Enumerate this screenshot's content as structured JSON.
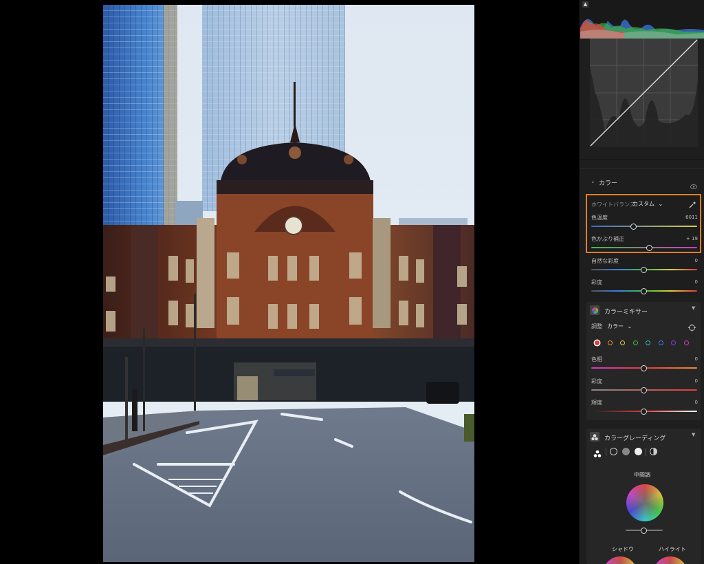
{
  "photo": {
    "description_name": "tokyo-station-photo"
  },
  "tone_curve": {},
  "color_section": {
    "title": "カラー",
    "white_balance": {
      "label": "ホワイトバランス",
      "preset": "カスタム"
    },
    "sliders": [
      {
        "key": "temp",
        "label": "色温度",
        "value": "6011",
        "position": 0.4
      },
      {
        "key": "tint",
        "label": "色かぶり補正",
        "value": "+ 19",
        "position": 0.55
      },
      {
        "key": "vibrance",
        "label": "自然な彩度",
        "value": "0",
        "position": 0.5
      },
      {
        "key": "saturation",
        "label": "彩度",
        "value": "0",
        "position": 0.5
      }
    ]
  },
  "color_mixer": {
    "title": "カラーミキサー",
    "adjust_label": "調整",
    "adjust_value": "カラー",
    "swatch_colors": [
      "#e23b3b",
      "#e8903a",
      "#e2cf3a",
      "#3fbf45",
      "#3ac3b6",
      "#3a7fe2",
      "#8a3ae2",
      "#cf3ac9"
    ],
    "sliders": [
      {
        "key": "hue",
        "label": "色相",
        "value": "0",
        "position": 0.5
      },
      {
        "key": "saturation",
        "label": "彩度",
        "value": "0",
        "position": 0.5
      },
      {
        "key": "luminance",
        "label": "輝度",
        "value": "0",
        "position": 0.5
      }
    ]
  },
  "color_grading": {
    "title": "カラーグレーディング",
    "midtones_label": "中間調",
    "shadows_label": "シャドウ",
    "highlights_label": "ハイライト"
  },
  "colors": {
    "accent_outline": "#e67e22",
    "panel_bg": "#1e1e1e"
  }
}
